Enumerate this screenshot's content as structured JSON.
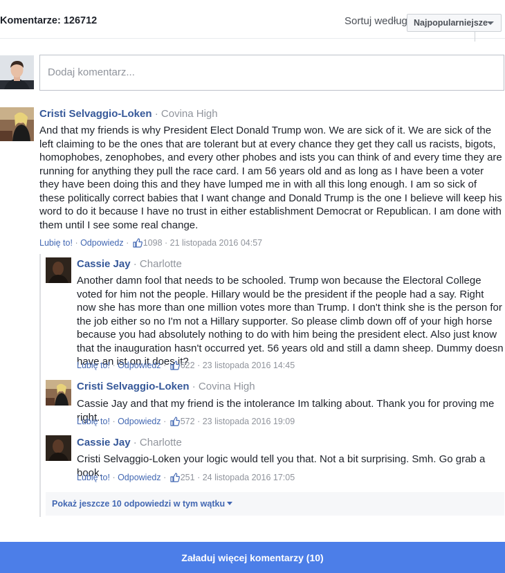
{
  "header": {
    "count_label": "Komentarze: 126712",
    "sort_label": "Sortuj według",
    "sort_value": "Najpopularniejsze"
  },
  "compose": {
    "placeholder": "Dodaj komentarz..."
  },
  "comments": [
    {
      "name": "Cristi Selvaggio-Loken",
      "affiliation": "Covina High",
      "text": "And that my friends is why President Elect Donald Trump won. We are sick of it. We are sick of the left claiming to be the ones that are tolerant but at every chance they get they call us racists, bigots, homophobes, zenophobes, and every other phobes and ists you can think of and every time they are running for anything they pull the race card. I am 56 years old and as long as I have been a voter they have been doing this and they have lumped me in with all this long enough. I am so sick of these politically correct babies that I want change and Donald Trump is the one I believe will keep his word to do it because I have no trust in either establishment Democrat or Republican. I am done with them until I see some real change.",
      "like": "Lubię to!",
      "reply": "Odpowiedz",
      "likes": "1098",
      "date": "21 listopada 2016 04:57"
    }
  ],
  "replies": [
    {
      "name": "Cassie Jay",
      "affiliation": "Charlotte",
      "text": "Another damn fool that needs to be schooled. Trump won because the Electoral College voted for him not the people. Hillary would be the president if the people had a say. Right now she has more than one million votes more than Trump. I don't think she is the person for the job either so no I'm not a Hillary supporter. So please climb down off of your high horse because you had absolutely nothing to do with him being the president elect. Also just know that the inauguration hasn't occurred yet. 56 years old and still a damn sheep. Dummy doesn have an ist on it does it?",
      "like": "Lubię to!",
      "reply": "Odpowiedz",
      "likes": "622",
      "date": "23 listopada 2016 14:45"
    },
    {
      "name": "Cristi Selvaggio-Loken",
      "affiliation": "Covina High",
      "text": "Cassie Jay and that my friend is the intolerance Im talking about. Thank you for proving me right.",
      "like": "Lubię to!",
      "reply": "Odpowiedz",
      "likes": "572",
      "date": "23 listopada 2016 19:09"
    },
    {
      "name": "Cassie Jay",
      "affiliation": "Charlotte",
      "text": "Cristi Selvaggio-Loken your logic would tell you that. Not a bit surprising. Smh. Go grab a book.",
      "like": "Lubię to!",
      "reply": "Odpowiedz",
      "likes": "251",
      "date": "24 listopada 2016 17:05"
    }
  ],
  "more_replies_label": "Pokaż jeszcze 10 odpowiedzi w tym wątku",
  "load_more_label": "Załaduj więcej komentarzy (10)",
  "colors": {
    "link": "#4267b2",
    "name": "#365899",
    "muted": "#90949c",
    "button": "#4c7ee8"
  },
  "icons": [
    "caret-down-icon",
    "thumbs-up-icon"
  ]
}
